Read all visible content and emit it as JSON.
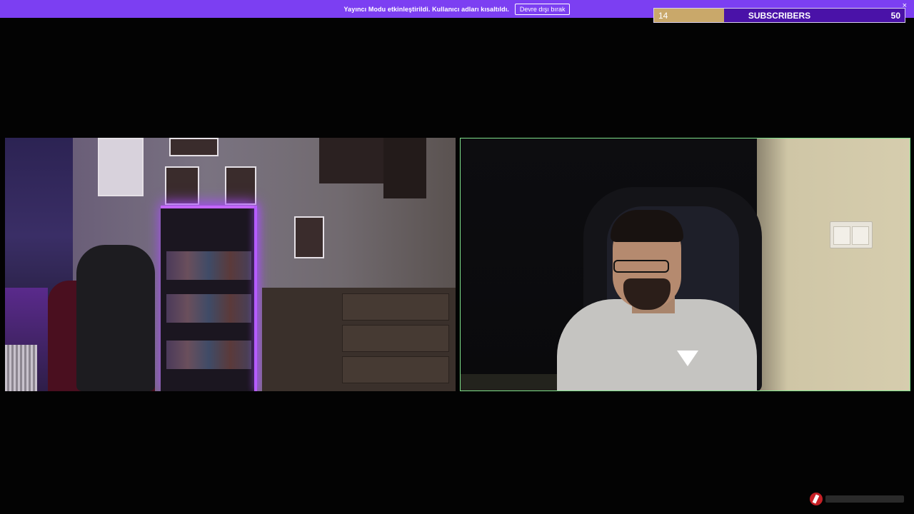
{
  "notice": {
    "text": "Yayıncı Modu etkinleştirildi. Kullanıcı adları kısaltıldı.",
    "button_label": "Devre dışı bırak",
    "close_glyph": "×"
  },
  "goal": {
    "current": "14",
    "label": "SUBSCRIBERS",
    "target": "50",
    "progress_fraction": 0.28,
    "colors": {
      "bar": "#4a12a8",
      "fill": "#c9a86a"
    }
  },
  "cameras": {
    "left": {
      "name": "room-camera"
    },
    "right": {
      "name": "streamer-camera",
      "border_color": "#7ee08a"
    }
  },
  "theme": {
    "notice_bar_color": "#7c3ff2",
    "background": "#030303"
  },
  "icons": {
    "watermark": "brand-logo-icon"
  }
}
